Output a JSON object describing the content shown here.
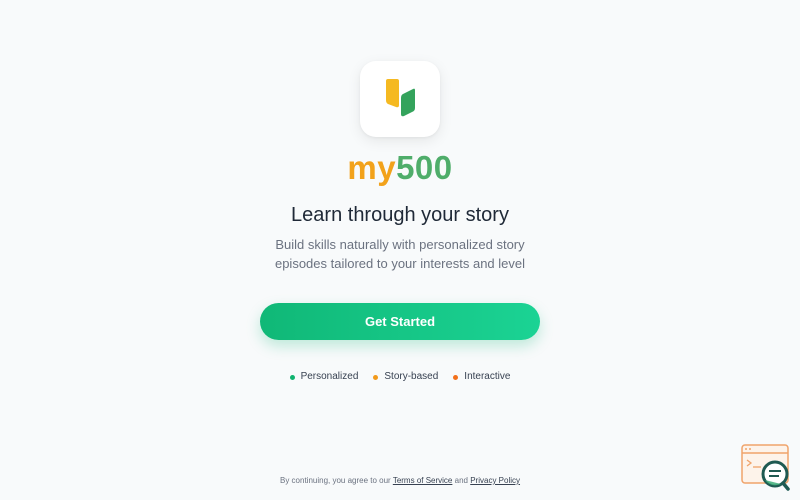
{
  "brand": {
    "prefix": "my",
    "number": "500",
    "logo_icon": "leaf-logo-icon",
    "colors": {
      "yellow": "#f2a21b",
      "green": "#4fad6a"
    }
  },
  "hero": {
    "headline": "Learn through your story",
    "subtext": "Build skills naturally with personalized story episodes tailored to your interests and level"
  },
  "cta": {
    "label": "Get Started",
    "color": "#10b877"
  },
  "features": [
    {
      "label": "Personalized",
      "color": "#10b36f"
    },
    {
      "label": "Story-based",
      "color": "#f29a1b"
    },
    {
      "label": "Interactive",
      "color": "#f2701b"
    }
  ],
  "footer": {
    "prefix": "By continuing, you agree to our",
    "terms_label": "Terms of Service",
    "and": "and",
    "privacy_label": "Privacy Policy"
  },
  "help_widget": {
    "icon": "chat-search-icon"
  }
}
